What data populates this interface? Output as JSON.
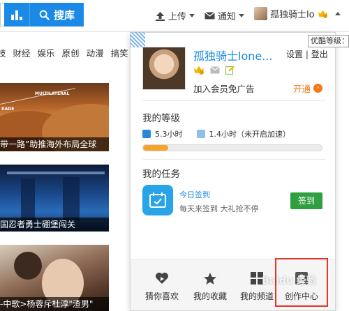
{
  "header": {
    "search_label": "搜库",
    "upload_label": "上传",
    "notify_label": "通知",
    "username_short": "孤独骑士lo"
  },
  "tooltip": {
    "text": "优酷等级："
  },
  "categories": [
    "技",
    "财经",
    "娱乐",
    "原创",
    "动漫",
    "搞笑"
  ],
  "videos": [
    {
      "caption": "带一路”助推海外布局全球",
      "overlay": "MULTILATERAL",
      "overlay2": "RADE"
    },
    {
      "caption": "国忍者勇士硼堡闯关"
    },
    {
      "caption": "-中歌>杨蓉斥杜淳\"渣男\""
    }
  ],
  "panel": {
    "username": "孤独骑士lone...",
    "settings": "设置",
    "separator": "|",
    "logout": "登出",
    "vip_promo": "加入会员免广告",
    "open_label": "开通",
    "level_title": "我的等级",
    "level_time1": "5.3小时",
    "level_time2": "1.4小时（未开启加速）",
    "level_progress_percent": 14,
    "task_title_section": "我的任务",
    "task_title": "今日签到",
    "task_desc": "每天来签到 大礼抢不停",
    "signin_label": "签到"
  },
  "bottom_nav": [
    {
      "label": "猜你喜欢",
      "icon": "heart-play-icon"
    },
    {
      "label": "我的收藏",
      "icon": "star-icon"
    },
    {
      "label": "我的频道",
      "icon": "grid-icon"
    },
    {
      "label": "创作中心",
      "icon": "creator-icon"
    }
  ],
  "watermark": "Baidu 经验",
  "colors": {
    "accent": "#1a8ae6",
    "orange": "#f07a17",
    "green": "#2f9f3f",
    "highlight": "#e6342b"
  }
}
